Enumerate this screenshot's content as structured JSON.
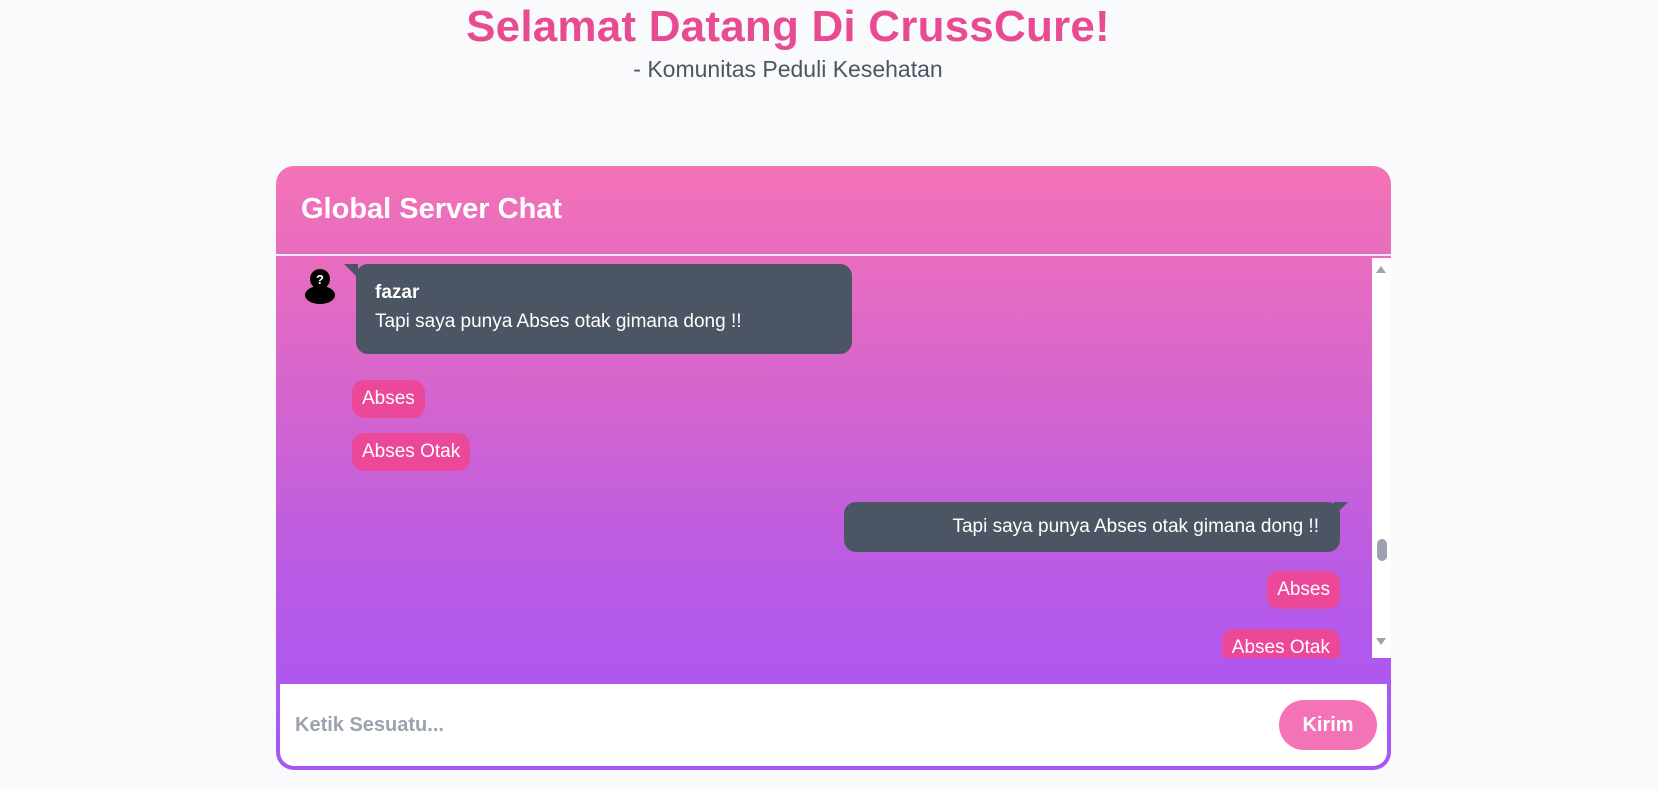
{
  "hero": {
    "title": "Selamat Datang Di CrussCure!",
    "subtitle": "- Komunitas Peduli Kesehatan"
  },
  "chat": {
    "title": "Global Server Chat",
    "messages": [
      {
        "side": "left",
        "sender": "fazar",
        "text": "Tapi saya punya Abses otak gimana dong !!",
        "tags": [
          "Abses",
          "Abses Otak"
        ]
      },
      {
        "side": "right",
        "text": "Tapi saya punya Abses otak gimana dong !!",
        "tags": [
          "Abses",
          "Abses Otak"
        ]
      }
    ],
    "composer": {
      "placeholder": "Ketik Sesuatu...",
      "send_label": "Kirim"
    }
  },
  "colors": {
    "accent": "#e94b93",
    "tag": "#ec4899",
    "bubble": "#4b5563",
    "gradient_top": "#f472b6",
    "gradient_bottom": "#a855f7"
  },
  "icons": {
    "avatar": "user-unknown-icon"
  }
}
